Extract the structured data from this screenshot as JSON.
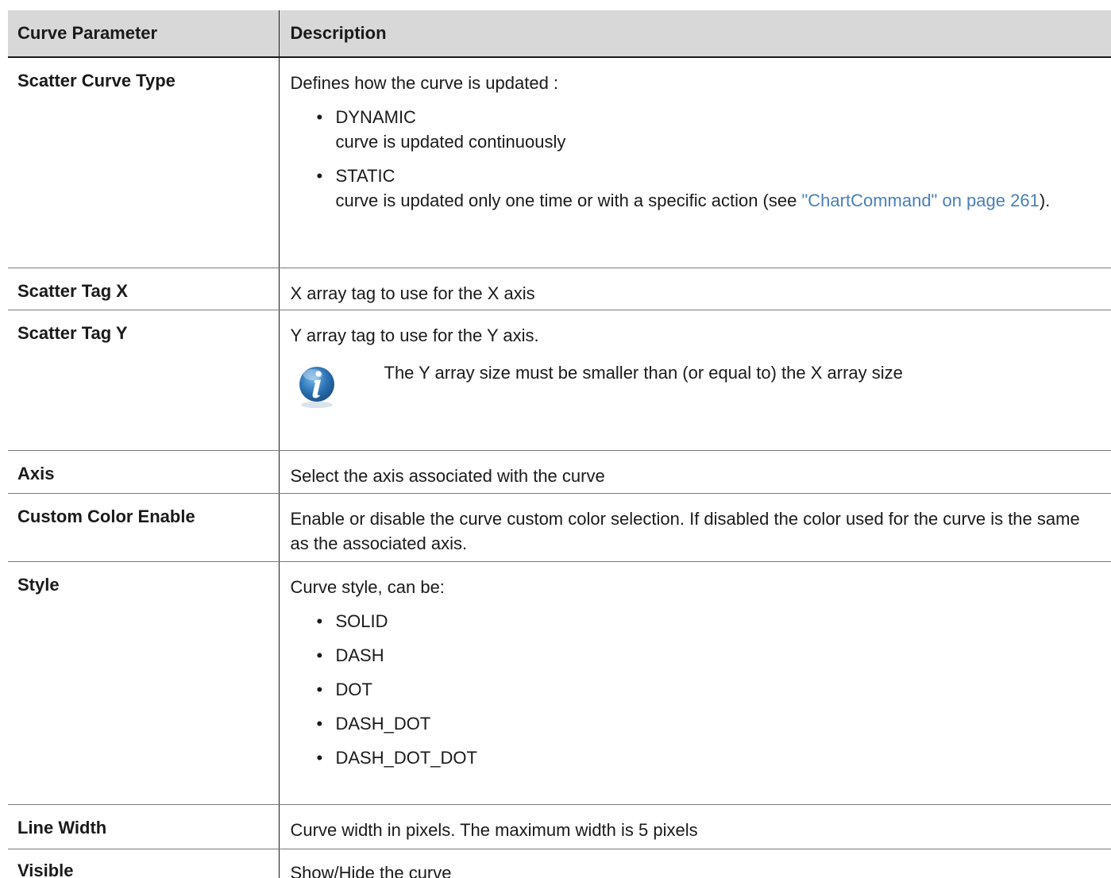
{
  "table": {
    "headers": [
      "Curve Parameter",
      "Description"
    ],
    "rows": [
      {
        "param": "Scatter Curve Type",
        "intro": "Defines how the curve is updated :",
        "bullets": [
          {
            "title": "DYNAMIC",
            "detail": "curve is updated continuously"
          },
          {
            "title": "STATIC",
            "detail_pre": "curve is updated only one time or with a specific action (see ",
            "link": "\"ChartCommand\" on page 261",
            "detail_post": ")."
          }
        ]
      },
      {
        "param": "Scatter Tag X",
        "desc": "X array tag to use for the X axis"
      },
      {
        "param": "Scatter Tag Y",
        "desc": "Y array tag to use for the Y axis.",
        "note": "The Y array size must be smaller than (or equal to) the X array size"
      },
      {
        "param": "Axis",
        "desc": "Select the axis associated with the curve"
      },
      {
        "param": "Custom Color Enable",
        "desc": "Enable or disable the curve custom color selection. If disabled the color used for the curve is the same as the associated axis."
      },
      {
        "param": "Style",
        "intro": "Curve style, can be:",
        "items": [
          "SOLID",
          "DASH",
          "DOT",
          "DASH_DOT",
          "DASH_DOT_DOT"
        ]
      },
      {
        "param": "Line Width",
        "desc": "Curve width in pixels. The maximum width is 5 pixels"
      },
      {
        "param": "Visible",
        "desc": "Show/Hide the curve"
      }
    ]
  },
  "icons": {
    "note": "info-icon"
  },
  "colors": {
    "link": "#4a7fb5",
    "header_bg": "#d8d8d8",
    "icon_blue": "#2a6fb0"
  }
}
